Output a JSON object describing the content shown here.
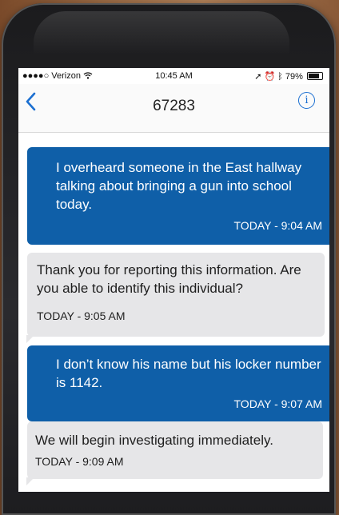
{
  "status_bar": {
    "signal": "●●●●○",
    "carrier": "Verizon",
    "time": "10:45 AM",
    "battery": "79%",
    "battery_level": 0.79
  },
  "header": {
    "title": "67283",
    "back_icon": "chevron-left-icon",
    "info_icon": "info-icon"
  },
  "colors": {
    "sent_bubble": "#0f5fa8",
    "received_bubble": "#e6e6e8",
    "accent": "#1b6fd1"
  },
  "messages": [
    {
      "direction": "sent",
      "text": "I overheard someone in the East hallway talking about bringing a gun into school today.",
      "timestamp": "TODAY - 9:04 AM"
    },
    {
      "direction": "received",
      "text": "Thank you for reporting this information. Are you able to identify this individual?",
      "timestamp": "TODAY - 9:05 AM"
    },
    {
      "direction": "sent",
      "text": "I don’t know his name but his locker number is 1142.",
      "timestamp": "TODAY - 9:07 AM"
    },
    {
      "direction": "received",
      "text": "We will begin investigating immediately.",
      "timestamp": "TODAY - 9:09 AM"
    }
  ]
}
